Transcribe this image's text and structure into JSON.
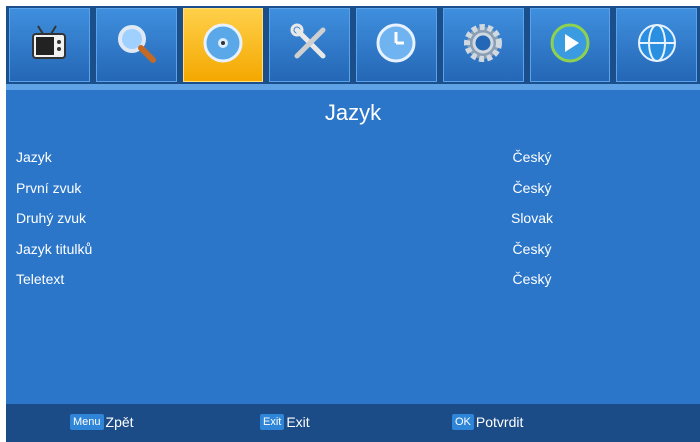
{
  "tabs": [
    {
      "icon": "tv-icon",
      "active": false
    },
    {
      "icon": "search-icon",
      "active": false
    },
    {
      "icon": "disc-icon",
      "active": true
    },
    {
      "icon": "tools-icon",
      "active": false
    },
    {
      "icon": "clock-icon",
      "active": false
    },
    {
      "icon": "gear-icon",
      "active": false
    },
    {
      "icon": "play-icon",
      "active": false
    },
    {
      "icon": "globe-icon",
      "active": false
    }
  ],
  "page": {
    "title": "Jazyk"
  },
  "settings": [
    {
      "label": "Jazyk",
      "value": "Český"
    },
    {
      "label": "První zvuk",
      "value": "Český"
    },
    {
      "label": "Druhý zvuk",
      "value": "Slovak"
    },
    {
      "label": "Jazyk titulků",
      "value": "Český"
    },
    {
      "label": "Teletext",
      "value": "Český"
    }
  ],
  "footer": {
    "menu_key": "Menu",
    "menu_label": "Zpět",
    "exit_key": "Exit",
    "exit_label": "Exit",
    "ok_key": "OK",
    "ok_label": "Potvrdit"
  },
  "colors": {
    "background": "#2b76c9",
    "active_tab": "#f4a800",
    "footer": "#1b4c88"
  }
}
